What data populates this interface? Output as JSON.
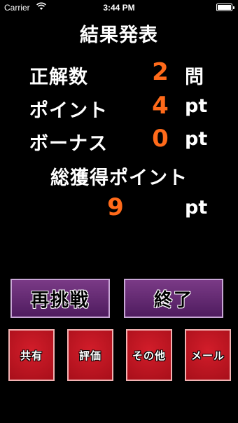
{
  "status": {
    "carrier": "Carrier",
    "time": "3:44 PM"
  },
  "title": "結果発表",
  "rows": [
    {
      "label": "正解数",
      "value": "2",
      "unit": "問"
    },
    {
      "label": "ポイント",
      "value": "4",
      "unit": "pt"
    },
    {
      "label": "ボーナス",
      "value": "0",
      "unit": "pt"
    }
  ],
  "total": {
    "label": "総獲得ポイント",
    "value": "9",
    "unit": "pt"
  },
  "buttons": {
    "retry": "再挑戦",
    "end": "終了",
    "share": "共有",
    "rate": "評価",
    "other": "その他",
    "mail": "メール"
  },
  "colors": {
    "value": "#ff6a1a",
    "purple_button": "#6a2a78",
    "red_button": "#c8141f"
  },
  "icons": {
    "wifi": "wifi-icon",
    "battery": "battery-icon"
  }
}
